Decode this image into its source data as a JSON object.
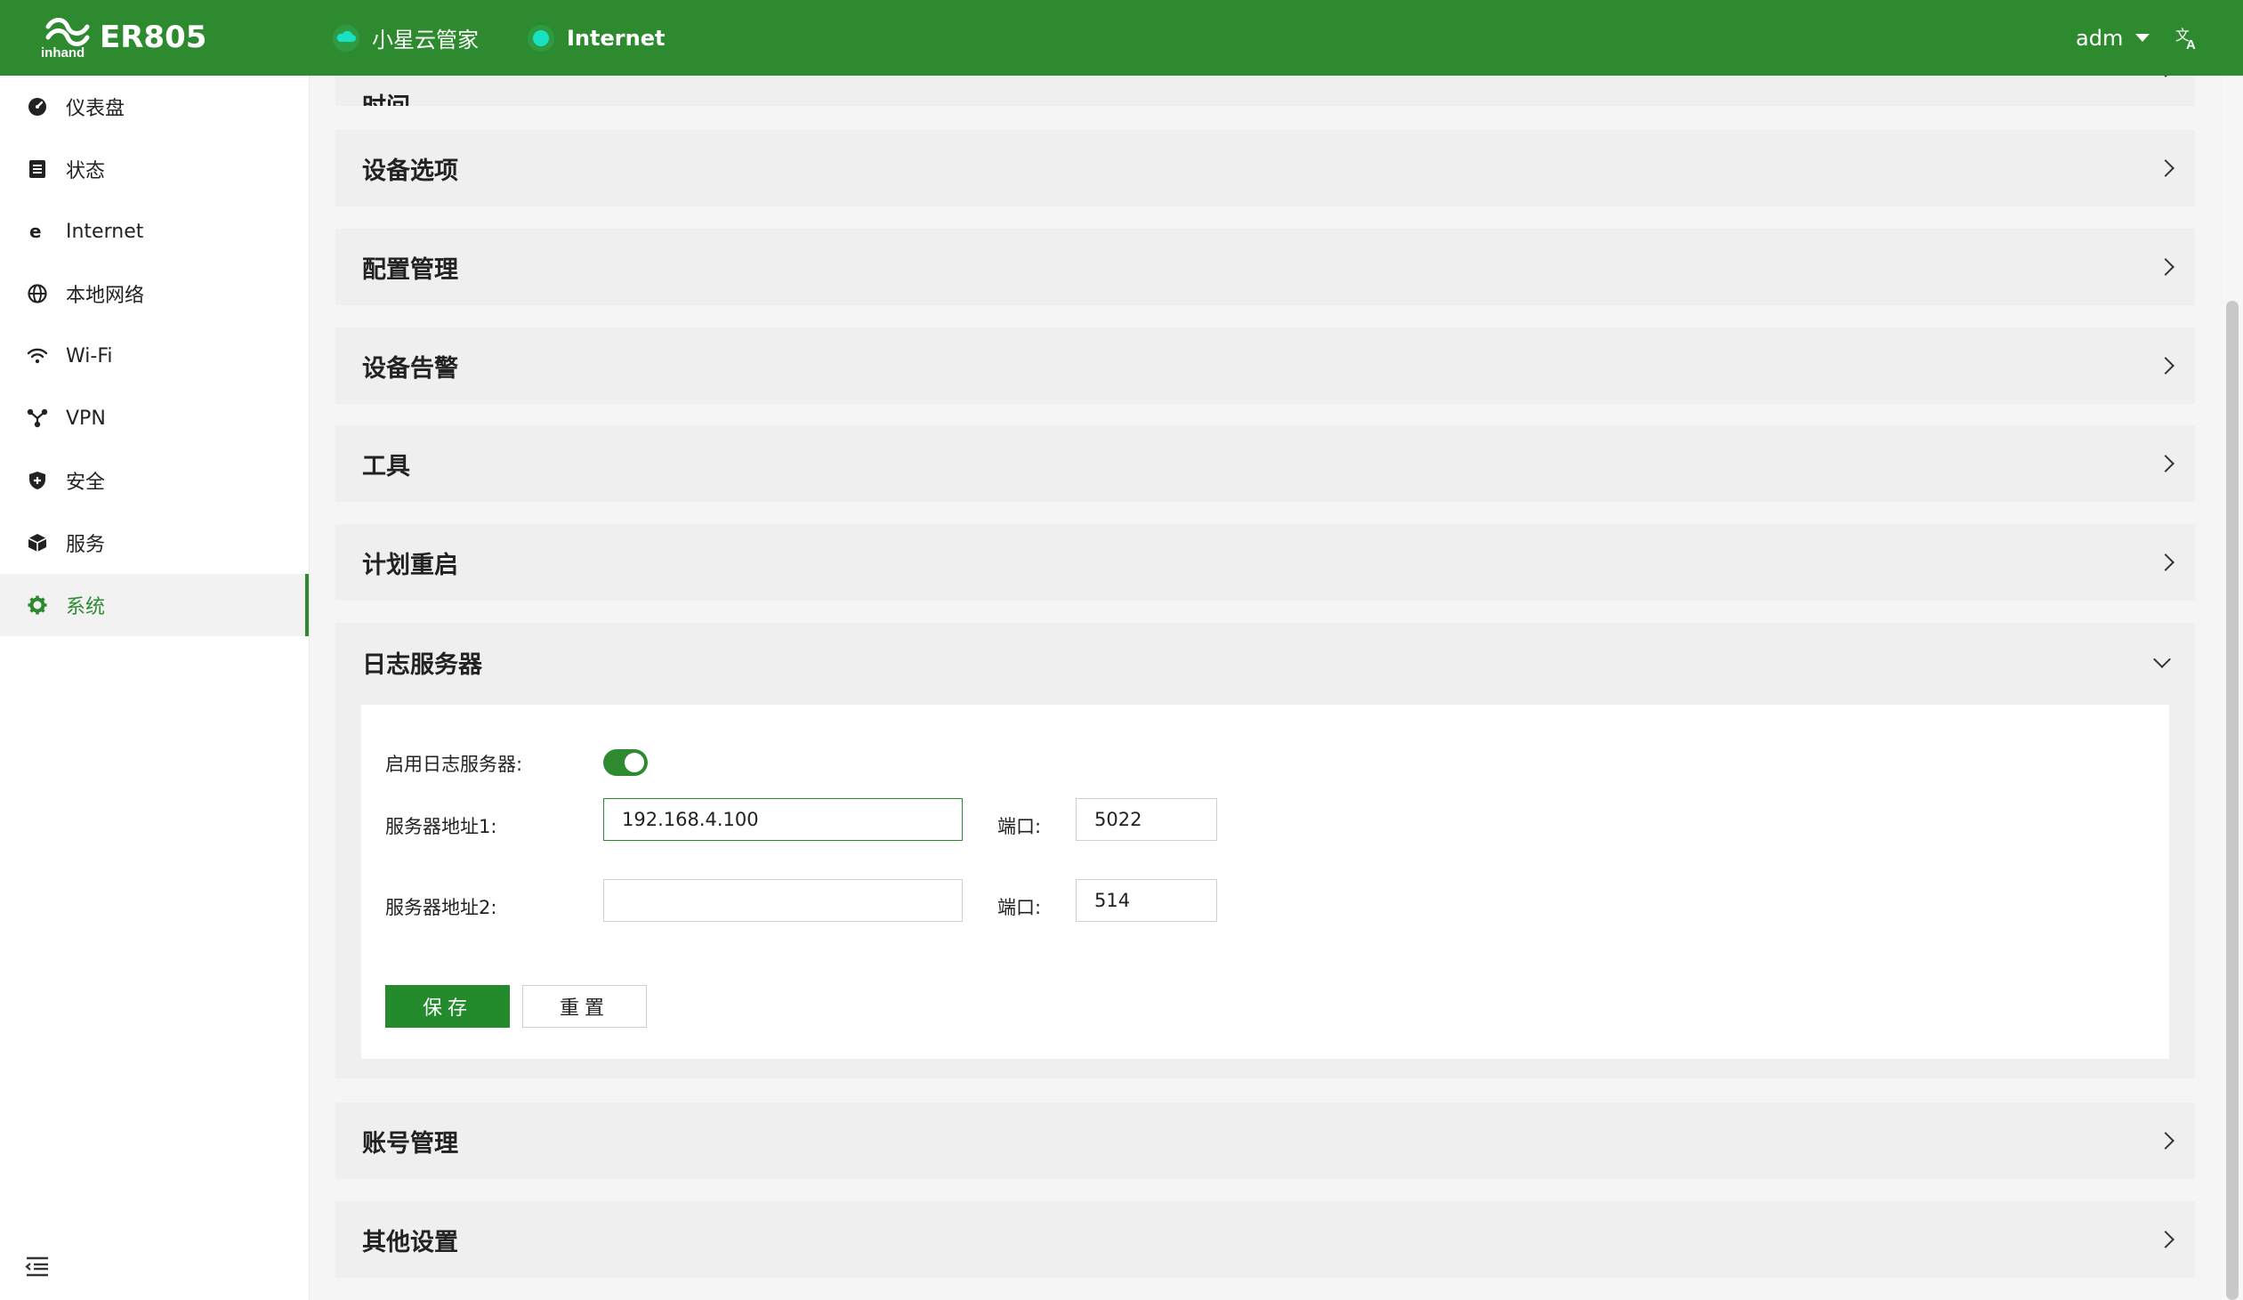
{
  "header": {
    "brand": "ER805",
    "cloud_label": "小星云管家",
    "internet_label": "Internet",
    "user": "adm",
    "brand_color": "#2d8a2f",
    "status_color": "#19e2c4"
  },
  "sidebar": {
    "items": [
      {
        "label": "仪表盘",
        "icon": "dashboard-icon"
      },
      {
        "label": "状态",
        "icon": "status-list-icon"
      },
      {
        "label": "Internet",
        "icon": "internet-icon"
      },
      {
        "label": "本地网络",
        "icon": "globe-icon"
      },
      {
        "label": "Wi-Fi",
        "icon": "wifi-icon"
      },
      {
        "label": "VPN",
        "icon": "vpn-icon"
      },
      {
        "label": "安全",
        "icon": "shield-icon"
      },
      {
        "label": "服务",
        "icon": "box-icon"
      },
      {
        "label": "系统",
        "icon": "gear-icon",
        "active": true
      }
    ]
  },
  "panels": {
    "top_cut": "时间",
    "device_options": "设备选项",
    "config_management": "配置管理",
    "device_alarm": "设备告警",
    "tools": "工具",
    "scheduled_reboot": "计划重启",
    "log_server": "日志服务器",
    "account_management": "账号管理",
    "other_settings": "其他设置"
  },
  "log_server_form": {
    "enable_label": "启用日志服务器:",
    "enabled": true,
    "server1_label": "服务器地址1:",
    "server1_value": "192.168.4.100",
    "port1_label": "端口:",
    "port1_value": "5022",
    "server2_label": "服务器地址2:",
    "server2_value": "",
    "port2_label": "端口:",
    "port2_value": "514",
    "save_label": "保存",
    "reset_label": "重置"
  }
}
